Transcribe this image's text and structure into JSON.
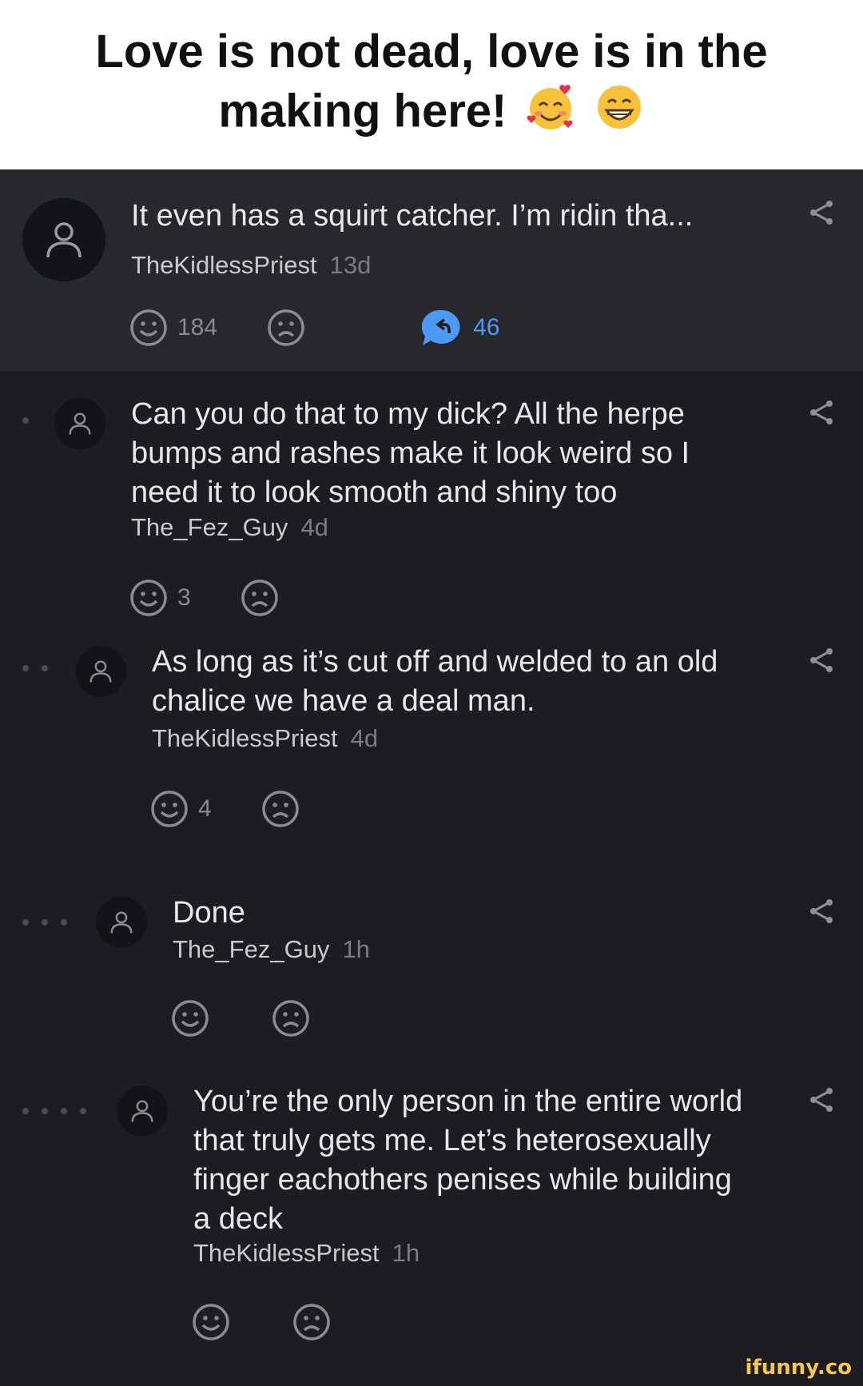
{
  "caption": {
    "text": "Love is not dead, love is in the making here!"
  },
  "op": {
    "text": "It even has a squirt catcher. I’m ridin tha...",
    "author": "TheKidlessPriest",
    "age": "13d",
    "likes": "184",
    "replies": "46"
  },
  "comments": [
    {
      "depth": 1,
      "text": "Can you do that to my dick? All the herpe bumps and rashes make it look weird so I need it to look smooth and shiny too",
      "author": "The_Fez_Guy",
      "age": "4d",
      "likes": "3"
    },
    {
      "depth": 2,
      "text": "As long as it’s cut off and welded to an old chalice we have a deal man.",
      "author": "TheKidlessPriest",
      "age": "4d",
      "likes": "4"
    },
    {
      "depth": 3,
      "text": "Done",
      "author": "The_Fez_Guy",
      "age": "1h",
      "likes": ""
    },
    {
      "depth": 4,
      "text": "You’re the only person in the entire world that truly gets me. Let’s heterosexually finger eachothers penises while building a deck",
      "author": "TheKidlessPriest",
      "age": "1h",
      "likes": ""
    }
  ],
  "icons": {
    "smile": "smile-icon",
    "frown": "frown-icon",
    "share": "share-icon",
    "reply": "reply-bubble-icon",
    "avatar": "user-avatar-icon"
  },
  "colors": {
    "accent": "#4d9af5",
    "background": "#1c1c22",
    "op_background": "#27272e"
  },
  "watermark": "ifunny.co"
}
